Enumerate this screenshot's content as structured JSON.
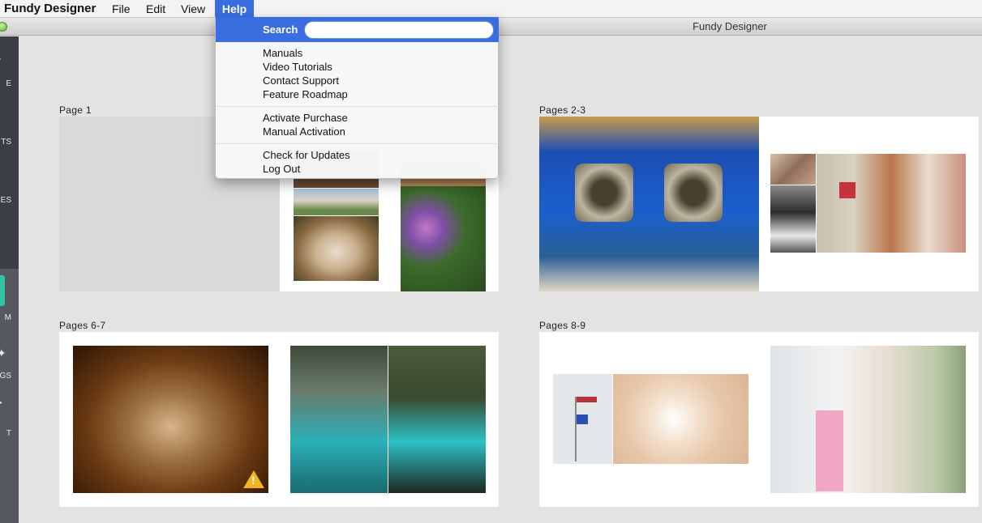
{
  "menubar": {
    "app_name": "Fundy Designer",
    "file": "File",
    "edit": "Edit",
    "view": "View",
    "help": "Help"
  },
  "window": {
    "title": "Fundy Designer"
  },
  "sidebar": {
    "items": [
      {
        "label": "E",
        "icon": "upload-icon"
      },
      {
        "label": "TS",
        "icon": "circle-icon"
      },
      {
        "label": "ES",
        "icon": "square-icon"
      },
      {
        "label": "M",
        "icon": "album-icon"
      },
      {
        "label": "GS",
        "icon": "gear-icon"
      },
      {
        "label": "T",
        "icon": "arrow-icon"
      }
    ]
  },
  "help_menu": {
    "search_label": "Search",
    "search_value": "",
    "group1": [
      "Manuals",
      "Video Tutorials",
      "Contact Support",
      "Feature Roadmap"
    ],
    "group2": [
      "Activate Purchase",
      "Manual Activation"
    ],
    "group3": [
      "Check for Updates",
      "Log Out"
    ]
  },
  "spreads": [
    {
      "label": "Page 1"
    },
    {
      "label": "Pages 2-3"
    },
    {
      "label": "Pages 6-7"
    },
    {
      "label": "Pages 8-9"
    }
  ],
  "colors": {
    "accent": "#3a6ee0",
    "sidebar_dark": "#3b3f44",
    "sidebar_active": "#2fc5a5",
    "warning": "#f2b51c"
  }
}
